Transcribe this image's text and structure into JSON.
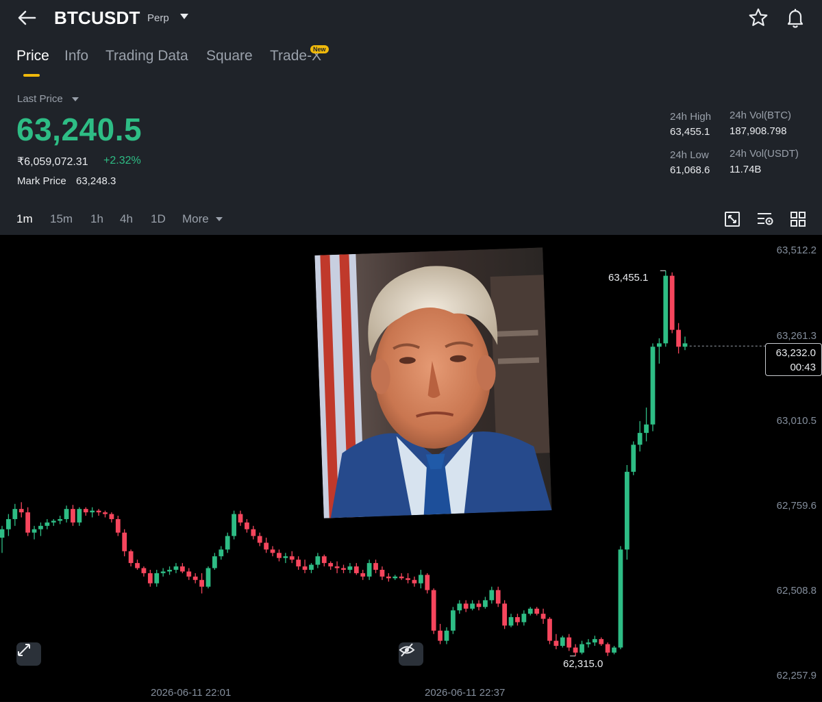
{
  "header": {
    "symbol": "BTCUSDT",
    "contract_type": "Perp"
  },
  "tabs": [
    {
      "label": "Price",
      "active": true
    },
    {
      "label": "Info",
      "active": false
    },
    {
      "label": "Trading Data",
      "active": false
    },
    {
      "label": "Square",
      "active": false
    },
    {
      "label": "Trade-X",
      "active": false,
      "badge": "New"
    }
  ],
  "ticker": {
    "last_price_label": "Last Price",
    "last_price": "63,240.5",
    "inr_price": "₹6,059,072.31",
    "change_pct": "+2.32%",
    "mark_price_label": "Mark Price",
    "mark_price": "63,248.3",
    "high_24h_label": "24h High",
    "high_24h": "63,455.1",
    "vol_btc_label": "24h Vol(BTC)",
    "vol_btc": "187,908.798",
    "low_24h_label": "24h Low",
    "low_24h": "61,068.6",
    "vol_usdt_label": "24h Vol(USDT)",
    "vol_usdt": "11.74B"
  },
  "intervals": [
    {
      "label": "1m",
      "active": true
    },
    {
      "label": "15m",
      "active": false
    },
    {
      "label": "1h",
      "active": false
    },
    {
      "label": "4h",
      "active": false
    },
    {
      "label": "1D",
      "active": false
    },
    {
      "label": "More",
      "active": false
    }
  ],
  "colors": {
    "up": "#2ebd85",
    "down": "#f6465d",
    "accent": "#f0b90b",
    "panel": "#1f2329"
  },
  "icons": [
    "back-arrow-icon",
    "caret-down-icon",
    "star-icon",
    "bell-icon",
    "chart-settings-icon",
    "indicator-settings-icon",
    "grid-layout-icon",
    "expand-icon",
    "hide-icon"
  ],
  "chart_data": {
    "type": "candlestick",
    "interval": "1m",
    "y_ticks": [
      "63,512.2",
      "63,261.3",
      "63,010.5",
      "62,759.6",
      "62,508.8",
      "62,257.9"
    ],
    "ylim": [
      62257.9,
      63512.2
    ],
    "x_ticks": [
      "2026-06-11 22:01",
      "2026-06-11 22:37"
    ],
    "max_label": "63,455.1",
    "min_label": "62,315.0",
    "current_price": "63,232.0",
    "countdown": "00:43",
    "ohlc": [
      [
        62665,
        62700,
        62620,
        62690
      ],
      [
        62690,
        62735,
        62670,
        62720
      ],
      [
        62720,
        62765,
        62700,
        62750
      ],
      [
        62750,
        62770,
        62725,
        62740
      ],
      [
        62740,
        62755,
        62670,
        62680
      ],
      [
        62680,
        62700,
        62660,
        62690
      ],
      [
        62690,
        62710,
        62670,
        62700
      ],
      [
        62700,
        62720,
        62690,
        62710
      ],
      [
        62710,
        62720,
        62700,
        62715
      ],
      [
        62715,
        62730,
        62705,
        62720
      ],
      [
        62720,
        62760,
        62710,
        62750
      ],
      [
        62750,
        62762,
        62700,
        62710
      ],
      [
        62710,
        62755,
        62700,
        62750
      ],
      [
        62750,
        62755,
        62730,
        62740
      ],
      [
        62740,
        62755,
        62725,
        62745
      ],
      [
        62745,
        62750,
        62730,
        62740
      ],
      [
        62740,
        62745,
        62725,
        62735
      ],
      [
        62735,
        62740,
        62710,
        62720
      ],
      [
        62720,
        62730,
        62670,
        62680
      ],
      [
        62680,
        62690,
        62610,
        62625
      ],
      [
        62625,
        62630,
        62580,
        62590
      ],
      [
        62590,
        62600,
        62570,
        62575
      ],
      [
        62575,
        62580,
        62550,
        62560
      ],
      [
        62560,
        62570,
        62520,
        62530
      ],
      [
        62530,
        62570,
        62520,
        62560
      ],
      [
        62560,
        62575,
        62550,
        62565
      ],
      [
        62565,
        62580,
        62555,
        62570
      ],
      [
        62570,
        62590,
        62560,
        62580
      ],
      [
        62580,
        62590,
        62560,
        62565
      ],
      [
        62565,
        62575,
        62540,
        62550
      ],
      [
        62550,
        62560,
        62530,
        62540
      ],
      [
        62540,
        62560,
        62500,
        62520
      ],
      [
        62520,
        62580,
        62515,
        62575
      ],
      [
        62575,
        62620,
        62570,
        62610
      ],
      [
        62610,
        62640,
        62600,
        62630
      ],
      [
        62630,
        62680,
        62620,
        62670
      ],
      [
        62670,
        62745,
        62660,
        62735
      ],
      [
        62735,
        62745,
        62700,
        62710
      ],
      [
        62710,
        62720,
        62680,
        62690
      ],
      [
        62690,
        62700,
        62660,
        62670
      ],
      [
        62670,
        62680,
        62640,
        62650
      ],
      [
        62650,
        62665,
        62620,
        62630
      ],
      [
        62630,
        62640,
        62610,
        62620
      ],
      [
        62620,
        62630,
        62595,
        62605
      ],
      [
        62605,
        62620,
        62590,
        62610
      ],
      [
        62610,
        62625,
        62590,
        62600
      ],
      [
        62600,
        62610,
        62570,
        62580
      ],
      [
        62580,
        62600,
        62560,
        62570
      ],
      [
        62570,
        62590,
        62560,
        62585
      ],
      [
        62585,
        62620,
        62575,
        62610
      ],
      [
        62610,
        62615,
        62580,
        62590
      ],
      [
        62590,
        62595,
        62570,
        62580
      ],
      [
        62580,
        62595,
        62560,
        62575
      ],
      [
        62575,
        62585,
        62560,
        62570
      ],
      [
        62570,
        62590,
        62560,
        62580
      ],
      [
        62580,
        62590,
        62555,
        62560
      ],
      [
        62560,
        62570,
        62540,
        62550
      ],
      [
        62550,
        62600,
        62540,
        62590
      ],
      [
        62590,
        62600,
        62560,
        62570
      ],
      [
        62570,
        62580,
        62540,
        62550
      ],
      [
        62550,
        62560,
        62535,
        62545
      ],
      [
        62545,
        62555,
        62540,
        62550
      ],
      [
        62550,
        62560,
        62540,
        62545
      ],
      [
        62545,
        62560,
        62530,
        62540
      ],
      [
        62540,
        62550,
        62520,
        62530
      ],
      [
        62530,
        62570,
        62515,
        62555
      ],
      [
        62555,
        62560,
        62500,
        62510
      ],
      [
        62510,
        62515,
        62380,
        62390
      ],
      [
        62390,
        62410,
        62350,
        62360
      ],
      [
        62360,
        62400,
        62350,
        62390
      ],
      [
        62390,
        62460,
        62380,
        62450
      ],
      [
        62450,
        62480,
        62440,
        62470
      ],
      [
        62470,
        62480,
        62445,
        62455
      ],
      [
        62455,
        62480,
        62450,
        62470
      ],
      [
        62470,
        62480,
        62450,
        62460
      ],
      [
        62460,
        62490,
        62455,
        62480
      ],
      [
        62480,
        62520,
        62470,
        62510
      ],
      [
        62510,
        62520,
        62460,
        62470
      ],
      [
        62470,
        62480,
        62395,
        62405
      ],
      [
        62405,
        62440,
        62400,
        62430
      ],
      [
        62430,
        62440,
        62405,
        62415
      ],
      [
        62415,
        62450,
        62405,
        62440
      ],
      [
        62440,
        62460,
        62435,
        62455
      ],
      [
        62455,
        62460,
        62435,
        62440
      ],
      [
        62440,
        62455,
        62410,
        62425
      ],
      [
        62425,
        62430,
        62350,
        62360
      ],
      [
        62360,
        62380,
        62335,
        62345
      ],
      [
        62345,
        62375,
        62340,
        62370
      ],
      [
        62370,
        62380,
        62330,
        62340
      ],
      [
        62340,
        62350,
        62315,
        62325
      ],
      [
        62325,
        62360,
        62320,
        62350
      ],
      [
        62350,
        62365,
        62340,
        62355
      ],
      [
        62355,
        62375,
        62345,
        62365
      ],
      [
        62365,
        62370,
        62345,
        62350
      ],
      [
        62350,
        62355,
        62315,
        62325
      ],
      [
        62325,
        62345,
        62320,
        62340
      ],
      [
        62340,
        62640,
        62335,
        62630
      ],
      [
        62630,
        62880,
        62600,
        62860
      ],
      [
        62860,
        62950,
        62850,
        62940
      ],
      [
        62940,
        63010,
        62920,
        62975
      ],
      [
        62975,
        63050,
        62950,
        63000
      ],
      [
        63000,
        63240,
        62980,
        63230
      ],
      [
        63230,
        63255,
        63180,
        63240
      ],
      [
        63240,
        63455,
        63230,
        63440
      ],
      [
        63440,
        63450,
        63270,
        63280
      ],
      [
        63280,
        63300,
        63210,
        63230
      ],
      [
        63230,
        63260,
        63220,
        63240
      ]
    ]
  }
}
